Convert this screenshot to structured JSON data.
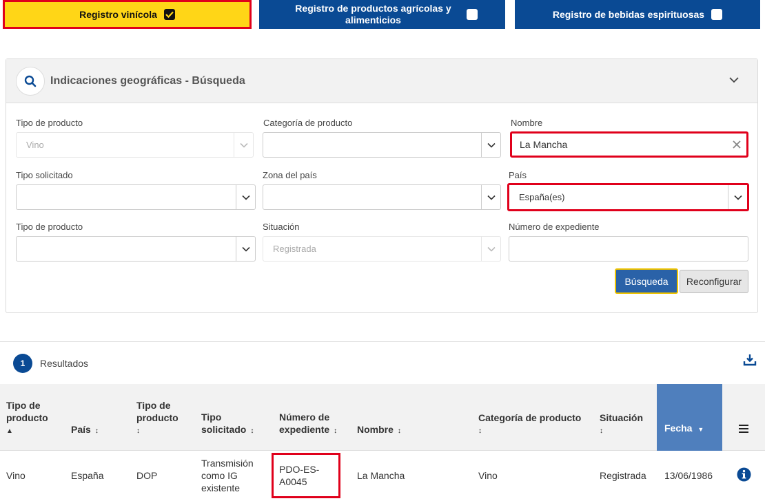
{
  "registries": {
    "wine": "Registro vinícola",
    "agri": "Registro de productos agrícolas y alimenticios",
    "spirits": "Registro de bebidas espirituosas"
  },
  "panel": {
    "title": "Indicaciones geográficas - Búsqueda"
  },
  "form": {
    "product_type_label": "Tipo de producto",
    "product_type_value": "Vino",
    "category_label": "Categoría de producto",
    "category_value": "",
    "name_label": "Nombre",
    "name_value": "La Mancha",
    "requested_type_label": "Tipo solicitado",
    "requested_type_value": "",
    "zone_label": "Zona del país",
    "zone_value": "",
    "country_label": "País",
    "country_value": "España(es)",
    "product_type2_label": "Tipo de producto",
    "product_type2_value": "",
    "status_label": "Situación",
    "status_value": "Registrada",
    "file_number_label": "Número de expediente",
    "file_number_value": "",
    "search_button": "Búsqueda",
    "reset_button": "Reconfigurar"
  },
  "results": {
    "count": "1",
    "label": "Resultados",
    "columns": {
      "product_type": "Tipo de producto",
      "country": "País",
      "product_type2": "Tipo de producto",
      "requested_type": "Tipo solicitado",
      "file_number": "Número de expediente",
      "name": "Nombre",
      "category": "Categoría de producto",
      "status": "Situación",
      "date": "Fecha"
    },
    "rows": [
      {
        "product_type": "Vino",
        "country": "España",
        "product_type2": "DOP",
        "requested_type": "Transmisión como IG existente",
        "file_number": "PDO-ES-A0045",
        "name": "La Mancha",
        "category": "Vino",
        "status": "Registrada",
        "date": "13/06/1986"
      }
    ]
  },
  "colors": {
    "accent_yellow": "#ffd617",
    "brand_blue": "#0a4a94",
    "highlight_red": "#e0001b",
    "sorted_column": "#4f7fbd"
  }
}
